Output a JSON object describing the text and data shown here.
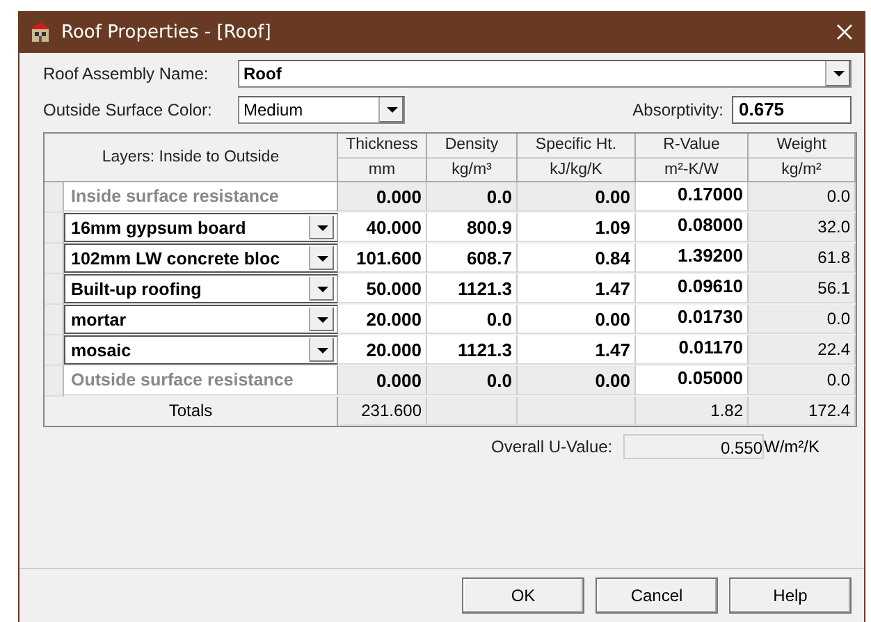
{
  "window": {
    "title": "Roof Properties - [Roof]"
  },
  "assembly_name": {
    "label": "Roof Assembly Name:",
    "value": "Roof"
  },
  "surface_color": {
    "label": "Outside Surface Color:",
    "value": "Medium"
  },
  "absorptivity": {
    "label": "Absorptivity:",
    "value": "0.675"
  },
  "table": {
    "columns": [
      {
        "title": "Layers: Inside to Outside"
      },
      {
        "title": "Thickness",
        "unit": "mm"
      },
      {
        "title": "Density",
        "unit": "kg/m³"
      },
      {
        "title": "Specific Ht.",
        "unit": "kJ/kg/K"
      },
      {
        "title": "R-Value",
        "unit": "m²-K/W"
      },
      {
        "title": "Weight",
        "unit": "kg/m²"
      }
    ],
    "rows": [
      {
        "kind": "fixed",
        "layer": "Inside surface resistance",
        "thickness": "0.000",
        "density": "0.0",
        "specific_heat": "0.00",
        "r_value": "0.17000",
        "weight": "0.0"
      },
      {
        "kind": "material",
        "layer": "16mm gypsum board",
        "thickness": "40.000",
        "density": "800.9",
        "specific_heat": "1.09",
        "r_value": "0.08000",
        "weight": "32.0"
      },
      {
        "kind": "material",
        "layer": "102mm LW concrete bloc",
        "thickness": "101.600",
        "density": "608.7",
        "specific_heat": "0.84",
        "r_value": "1.39200",
        "weight": "61.8"
      },
      {
        "kind": "material",
        "layer": "Built-up roofing",
        "thickness": "50.000",
        "density": "1121.3",
        "specific_heat": "1.47",
        "r_value": "0.09610",
        "weight": "56.1"
      },
      {
        "kind": "material",
        "layer": "mortar",
        "thickness": "20.000",
        "density": "0.0",
        "specific_heat": "0.00",
        "r_value": "0.01730",
        "weight": "0.0"
      },
      {
        "kind": "material",
        "layer": "mosaic",
        "thickness": "20.000",
        "density": "1121.3",
        "specific_heat": "1.47",
        "r_value": "0.01170",
        "weight": "22.4"
      },
      {
        "kind": "fixed",
        "layer": "Outside surface resistance",
        "thickness": "0.000",
        "density": "0.0",
        "specific_heat": "0.00",
        "r_value": "0.05000",
        "weight": "0.0"
      }
    ],
    "totals": {
      "label": "Totals",
      "thickness": "231.600",
      "r_value": "1.82",
      "weight": "172.4"
    }
  },
  "u_value": {
    "label": "Overall U-Value:",
    "value": "0.550",
    "unit": "W/m²/K"
  },
  "buttons": [
    {
      "label": "OK"
    },
    {
      "label": "Cancel"
    },
    {
      "label": "Help"
    }
  ]
}
